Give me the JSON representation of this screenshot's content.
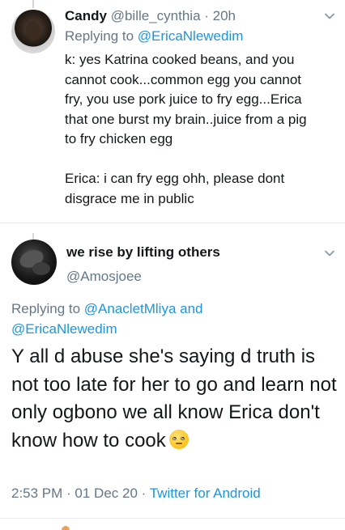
{
  "reply_tweet": {
    "display_name": "Candy",
    "handle": "@bille_cynthia",
    "separator": " · ",
    "time": "20h",
    "replying_prefix": "Replying to ",
    "replying_to": "@EricaNlewedim",
    "body": "k: yes Katrina cooked beans, and you\ncannot cook...common egg you cannot\nfry, you use pork juice to fry egg...Erica\nthat one burst my brain..juice from a pig\nto fry chicken egg\n\nErica: i can fry egg ohh, please dont\ndisgrace me in public"
  },
  "main_tweet": {
    "display_name": "we rise by lifting others",
    "handle": "@Amosjoee",
    "replying_prefix": "Replying to ",
    "replying_to_1": "@AnacletMliya",
    "replying_and": " and",
    "replying_to_2": "@EricaNlewedim",
    "body": "Y all d abuse she's saying d truth is not too late for her to go and learn not only ogbono we all know Erica don't know how to cook",
    "emoji": "face-with-rolling-eyes",
    "time": "2:53 PM",
    "meta_sep": " · ",
    "date": "01 Dec 20",
    "source": "Twitter for Android"
  },
  "icons": {
    "menu": "chevron-down-icon"
  },
  "colors": {
    "text": "#14171a",
    "secondary": "#657786",
    "link": "#1b95e0",
    "divider": "#e6ecf0"
  }
}
